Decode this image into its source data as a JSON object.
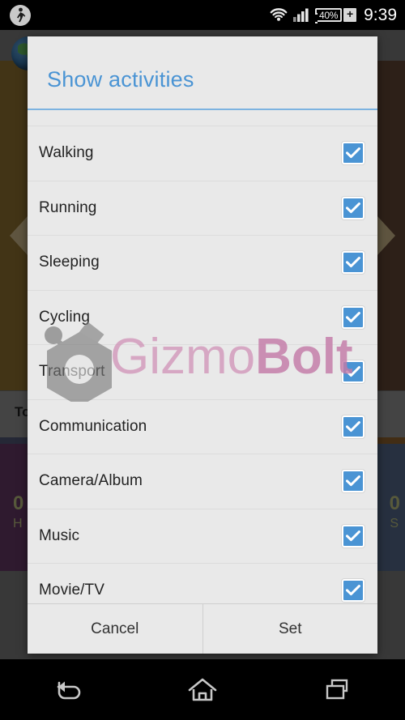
{
  "status_bar": {
    "left_icon": "walking-person-icon",
    "wifi_icon": "wifi-icon",
    "signal_icon": "cellular-signal-icon",
    "battery_percent": "40%",
    "battery_charging_glyph": "+",
    "clock": "9:39"
  },
  "background_app": {
    "globe_icon": "globe-icon",
    "chevron_left_icon": "chevron-left-icon",
    "chevron_right_icon": "chevron-right-icon",
    "gray_bar_label": "To",
    "purple_card_value": "0",
    "purple_card_unit": "H",
    "blue_card_value": "0",
    "blue_card_unit": "S"
  },
  "dialog": {
    "title": "Show activities",
    "items": [
      {
        "label": "Walking",
        "checked": true
      },
      {
        "label": "Running",
        "checked": true
      },
      {
        "label": "Sleeping",
        "checked": true
      },
      {
        "label": "Cycling",
        "checked": true
      },
      {
        "label": "Transport",
        "checked": true
      },
      {
        "label": "Communication",
        "checked": true
      },
      {
        "label": "Camera/Album",
        "checked": true
      },
      {
        "label": "Music",
        "checked": true
      },
      {
        "label": "Movie/TV",
        "checked": true
      }
    ],
    "cancel_label": "Cancel",
    "set_label": "Set"
  },
  "watermark": {
    "text_light": "Gizmo",
    "text_bold": "Bolt",
    "logo_icon": "gizmobolt-hexagon-logo"
  },
  "nav_bar": {
    "back_label": "back-icon",
    "home_label": "home-icon",
    "recents_label": "recents-icon"
  },
  "colors": {
    "accent_blue": "#4a94d4",
    "title_blue": "#4a94d4",
    "dialog_bg": "#e9e9e9",
    "watermark_pink": "#c47ba8",
    "status_bar_bg": "#000000"
  }
}
